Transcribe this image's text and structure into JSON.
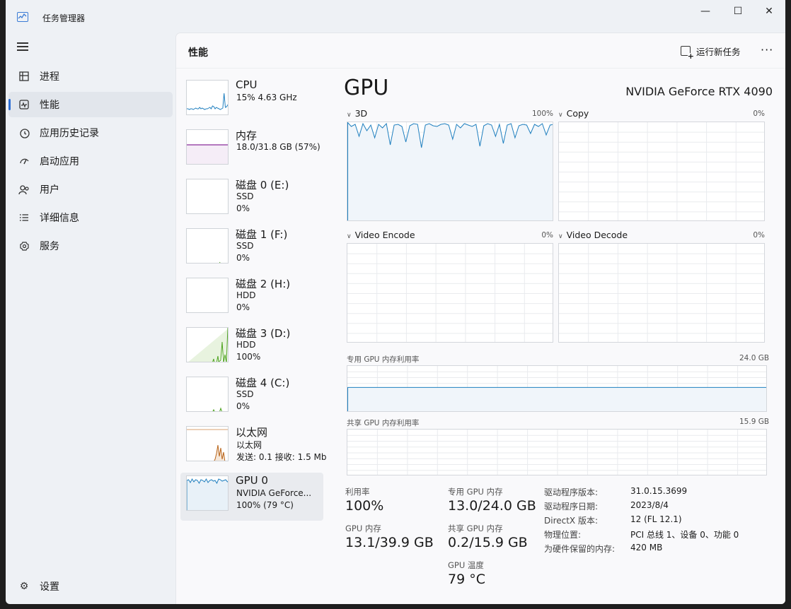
{
  "window": {
    "title": "任务管理器",
    "controls": {
      "minimize": "—",
      "maximize": "☐",
      "close": "✕"
    }
  },
  "sidebar": {
    "items": [
      {
        "label": "进程",
        "icon": "processes-icon"
      },
      {
        "label": "性能",
        "icon": "performance-icon",
        "active": true
      },
      {
        "label": "应用历史记录",
        "icon": "history-icon"
      },
      {
        "label": "启动应用",
        "icon": "startup-icon"
      },
      {
        "label": "用户",
        "icon": "users-icon"
      },
      {
        "label": "详细信息",
        "icon": "details-icon"
      },
      {
        "label": "服务",
        "icon": "services-icon"
      }
    ],
    "settings": {
      "label": "设置",
      "icon": "gear-icon"
    }
  },
  "header": {
    "title": "性能",
    "run_task": "运行新任务",
    "more": "···"
  },
  "devices": [
    {
      "name": "CPU",
      "line1": "15% 4.63 GHz",
      "line2": "",
      "color": "#1f7fbf"
    },
    {
      "name": "内存",
      "line1": "18.0/31.8 GB (57%)",
      "line2": "",
      "color": "#8b2c9a"
    },
    {
      "name": "磁盘 0 (E:)",
      "line1": "SSD",
      "line2": "0%",
      "color": "#4da31e"
    },
    {
      "name": "磁盘 1 (F:)",
      "line1": "SSD",
      "line2": "0%",
      "color": "#4da31e"
    },
    {
      "name": "磁盘 2 (H:)",
      "line1": "HDD",
      "line2": "0%",
      "color": "#4da31e"
    },
    {
      "name": "磁盘 3 (D:)",
      "line1": "HDD",
      "line2": "100%",
      "color": "#4da31e"
    },
    {
      "name": "磁盘 4 (C:)",
      "line1": "SSD",
      "line2": "0%",
      "color": "#4da31e"
    },
    {
      "name": "以太网",
      "line1": "以太网",
      "line2": "发送: 0.1 接收: 1.5 Mb",
      "color": "#b9651a"
    },
    {
      "name": "GPU 0",
      "line1": "NVIDIA GeForce...",
      "line2": "100% (79 °C)",
      "color": "#1f7fbf",
      "active": true
    }
  ],
  "gpu": {
    "title": "GPU",
    "model": "NVIDIA GeForce RTX 4090",
    "engines": [
      {
        "label": "3D",
        "percent": "100%"
      },
      {
        "label": "Copy",
        "percent": "0%"
      },
      {
        "label": "Video Encode",
        "percent": "0%"
      },
      {
        "label": "Video Decode",
        "percent": "0%"
      }
    ],
    "dedicated_mem": {
      "label": "专用 GPU 内存利用率",
      "max": "24.0 GB",
      "fraction": 0.54
    },
    "shared_mem": {
      "label": "共享 GPU 内存利用率",
      "max": "15.9 GB",
      "fraction": 0.01
    },
    "stats": {
      "utilization_label": "利用率",
      "utilization": "100%",
      "gpu_mem_label": "GPU 内存",
      "gpu_mem": "13.1/39.9 GB",
      "dedicated_label": "专用 GPU 内存",
      "dedicated": "13.0/24.0 GB",
      "shared_label": "共享 GPU 内存",
      "shared": "0.2/15.9 GB",
      "temp_label": "GPU 温度",
      "temp": "79 °C"
    },
    "info": [
      {
        "key": "驱动程序版本:",
        "value": "31.0.15.3699"
      },
      {
        "key": "驱动程序日期:",
        "value": "2023/8/4"
      },
      {
        "key": "DirectX 版本:",
        "value": "12 (FL 12.1)"
      },
      {
        "key": "物理位置:",
        "value": "PCI 总线 1、设备 0、功能 0"
      },
      {
        "key": "为硬件保留的内存:",
        "value": "420 MB"
      }
    ]
  },
  "colors": {
    "accent": "#2c6ed5",
    "gpu_line": "#1f7fbf",
    "gpu_fill": "#f0f5fa",
    "grid": "#e9ebee"
  }
}
